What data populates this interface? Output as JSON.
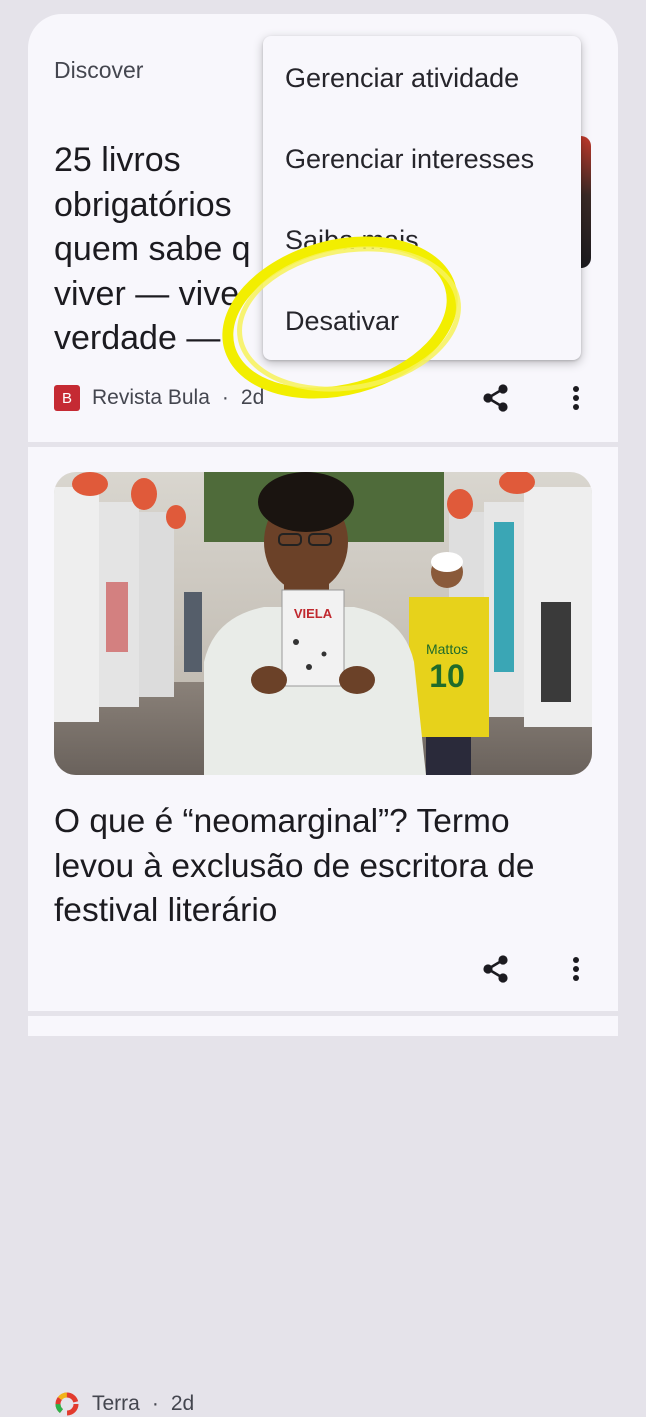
{
  "card1": {
    "section_label": "Discover",
    "title": "25 livros\nobrigatórios\nquem sabe q\nviver — vive\nverdade — ",
    "source": "Revista Bula",
    "age": "2d",
    "badge_letter": "B"
  },
  "menu": {
    "items": [
      "Gerenciar atividade",
      "Gerenciar interesses",
      "Saiba mais",
      "Desativar"
    ]
  },
  "card2": {
    "book_text": "VIELA",
    "jersey_name": "Mattos",
    "jersey_number": "10",
    "title": "O que é “neomarginal”? Termo levou à exclusão de escritora de festival literário",
    "source": "Terra",
    "age": "2d"
  },
  "colors": {
    "highlight": "#f2ee00",
    "bula_badge": "#c52a33",
    "text": "#1c1b20"
  },
  "icons": [
    "share-icon",
    "more-vert-icon",
    "terra-logo-icon"
  ]
}
